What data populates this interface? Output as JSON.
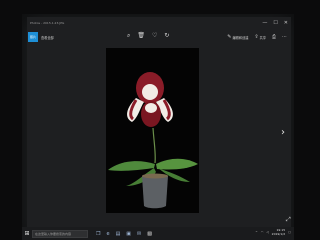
{
  "window": {
    "title": "Photos - 2015.1.23.JPG",
    "controls": [
      "—",
      "☐",
      "✕"
    ]
  },
  "toolbar": {
    "back_label": "照片",
    "collection_label": "查看全部",
    "center_icons": [
      "zoom-icon",
      "delete-icon",
      "favorite-icon",
      "rotate-icon"
    ],
    "edit_label": "编辑和创建",
    "share_label": "共享",
    "print_icon": "print-icon",
    "more_icon": "more-icon"
  },
  "photo": {
    "subject": "potted orchid",
    "colors": {
      "petal": "#8a1c28",
      "white": "#f2ece6",
      "leaf": "#4f8a3c",
      "pot": "#5c6064"
    }
  },
  "navigation": {
    "next_icon": "chevron-right-icon"
  },
  "taskbar": {
    "search_placeholder": "在这里输入你要搜索的内容",
    "time": "19:15",
    "date": "2019/1/2"
  }
}
